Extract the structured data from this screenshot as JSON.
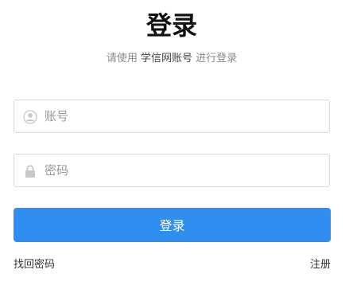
{
  "header": {
    "title": "登录",
    "subtitle_prefix": "请使用",
    "subtitle_account": "学信网账号",
    "subtitle_suffix": "进行登录"
  },
  "form": {
    "account_placeholder": "账号",
    "account_value": "",
    "account_icon": "user-icon",
    "password_placeholder": "密码",
    "password_value": "",
    "password_icon": "lock-icon",
    "submit_label": "登录"
  },
  "footer": {
    "forgot_label": "找回密码",
    "register_label": "注册"
  },
  "colors": {
    "primary": "#2f8ef0",
    "border": "#d9d9d9",
    "placeholder": "#999999",
    "muted_text": "#888888"
  }
}
